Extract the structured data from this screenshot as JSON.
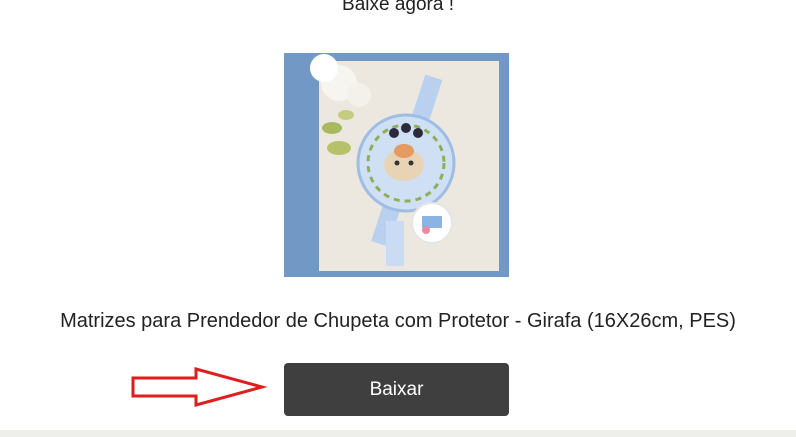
{
  "header": {
    "cta_text": "Baixe agora !"
  },
  "product": {
    "title": "Matrizes para Prendedor de Chupeta com Protetor - Girafa (16X26cm, PES)",
    "image_alt": "Prendedor de chupeta bordado com girafa"
  },
  "actions": {
    "download_label": "Baixar"
  },
  "colors": {
    "image_background": "#7298c5",
    "button_background": "#3f3f3f",
    "arrow": "#e01e1e"
  }
}
